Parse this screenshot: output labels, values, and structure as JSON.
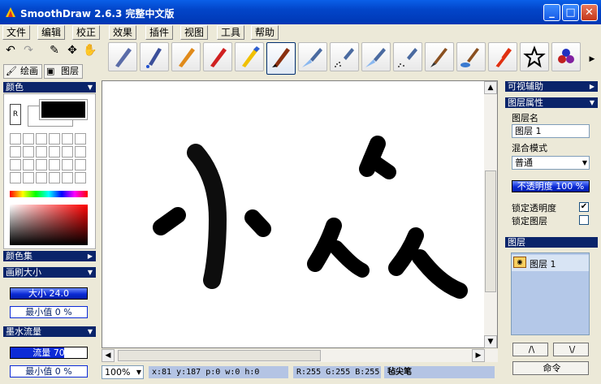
{
  "app": {
    "title": "SmoothDraw 2.6.3 完整中文版",
    "minimize": "_",
    "maximize": "□",
    "close": "✕"
  },
  "menu": [
    "文件",
    "编辑",
    "校正",
    "效果",
    "插件",
    "视图",
    "工具",
    "帮助"
  ],
  "tabs": {
    "draw": "绘画",
    "layers": "图层"
  },
  "brushes": [
    "pen",
    "fountain-pen",
    "pencil",
    "crayon",
    "marker",
    "brush",
    "airbrush",
    "spray",
    "airbrush2",
    "spray2",
    "oil-brush",
    "water-brush",
    "knife",
    "star",
    "flower"
  ],
  "left": {
    "color_title": "颜色",
    "r_label": "R",
    "color_set_title": "颜色集",
    "brush_size_title": "画刷大小",
    "size": "大小 24.0",
    "min1": "最小值 0 %",
    "ink_flow_title": "墨水流量",
    "flow": "流量 70",
    "min2": "最小值 0 %"
  },
  "right": {
    "visual_aid": "可视辅助",
    "layer_props": "图层属性",
    "layer_name_label": "图层名",
    "layer_name": "图层 1",
    "blend_label": "混合模式",
    "blend": "普通",
    "opacity": "不透明度 100 %",
    "lock_opacity": "锁定透明度",
    "lock_layer": "锁定图层",
    "layers_title": "图层",
    "layer_item": "图层 1",
    "up": "/\\",
    "down": "\\/",
    "command": "命令"
  },
  "status": {
    "zoom": "100%",
    "coords": "x:81 y:187 p:0  w:0 h:0",
    "rgb": "R:255 G:255 B:255",
    "tool": "毡尖笔"
  },
  "colors": {
    "accent": "#0a246a",
    "bluebar": "#0c2bd6"
  }
}
